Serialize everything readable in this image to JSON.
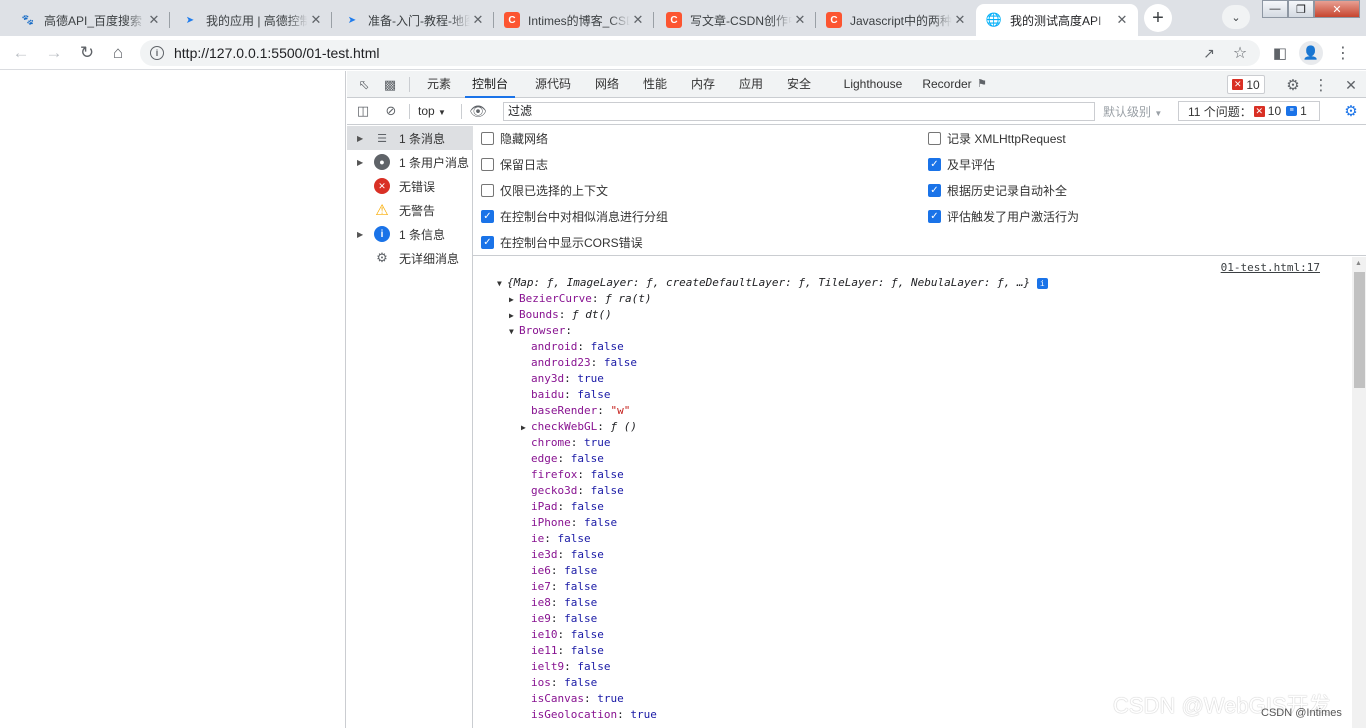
{
  "tabs": [
    {
      "title": "高德API_百度搜索",
      "icon": "baidu-paw-icon"
    },
    {
      "title": "我的应用 | 高德控制台",
      "icon": "amap-arrow-icon"
    },
    {
      "title": "准备-入门-教程-地图",
      "icon": "amap-arrow-icon"
    },
    {
      "title": "Intimes的博客_CSDN",
      "icon": "csdn-icon"
    },
    {
      "title": "写文章-CSDN创作中心",
      "icon": "csdn-icon"
    },
    {
      "title": "Javascript中的两种",
      "icon": "csdn-icon"
    },
    {
      "title": "我的测试高度API",
      "icon": "globe-icon"
    }
  ],
  "address": {
    "url": "http://127.0.0.1:5500/01-test.html",
    "host": "127.0.0.1:5500/01-test.html",
    "scheme": "http://"
  },
  "devtools": {
    "tabs": [
      "元素",
      "控制台",
      "源代码",
      "网络",
      "性能",
      "内存",
      "应用",
      "安全",
      "Lighthouse",
      "Recorder"
    ],
    "error_count": "10",
    "context": "top",
    "filter_placeholder": "过滤",
    "levels_label": "默认级别",
    "issues_label": "11 个问题：",
    "issues_errors": "10",
    "issues_info": "1"
  },
  "sidebar": [
    {
      "label": "1 条消息",
      "icon": "list-icon",
      "expandable": true
    },
    {
      "label": "1 条用户消息",
      "icon": "user-icon",
      "expandable": true
    },
    {
      "label": "无错误",
      "icon": "error-icon",
      "expandable": false
    },
    {
      "label": "无警告",
      "icon": "warning-icon",
      "expandable": false
    },
    {
      "label": "1 条信息",
      "icon": "info-icon",
      "expandable": true
    },
    {
      "label": "无详细消息",
      "icon": "verbose-bug-icon",
      "expandable": false
    }
  ],
  "settings": {
    "left": [
      {
        "label": "隐藏网络",
        "checked": false
      },
      {
        "label": "保留日志",
        "checked": false
      },
      {
        "label": "仅限已选择的上下文",
        "checked": false
      },
      {
        "label": "在控制台中对相似消息进行分组",
        "checked": true
      },
      {
        "label": "在控制台中显示CORS错误",
        "checked": true
      }
    ],
    "right": [
      {
        "label": "记录 XMLHttpRequest",
        "checked": false
      },
      {
        "label": "及早评估",
        "checked": true
      },
      {
        "label": "根据历史记录自动补全",
        "checked": true
      },
      {
        "label": "评估触发了用户激活行为",
        "checked": true
      }
    ]
  },
  "console": {
    "source_link": "01-test.html:17",
    "summary": "{Map: ƒ, ImageLayer: ƒ, createDefaultLayer: ƒ, TileLayer: ƒ, NebulaLayer: ƒ, …}",
    "top_props": [
      {
        "key": "BezierCurve",
        "val": "ƒ ra(t)"
      },
      {
        "key": "Bounds",
        "val": "ƒ dt()"
      }
    ],
    "browser_key": "Browser",
    "browser_props": [
      {
        "key": "android",
        "val": "false",
        "t": "b"
      },
      {
        "key": "android23",
        "val": "false",
        "t": "b"
      },
      {
        "key": "any3d",
        "val": "true",
        "t": "b"
      },
      {
        "key": "baidu",
        "val": "false",
        "t": "b"
      },
      {
        "key": "baseRender",
        "val": "\"w\"",
        "t": "s"
      },
      {
        "key": "checkWebGL",
        "val": "ƒ ()",
        "t": "f"
      },
      {
        "key": "chrome",
        "val": "true",
        "t": "b"
      },
      {
        "key": "edge",
        "val": "false",
        "t": "b"
      },
      {
        "key": "firefox",
        "val": "false",
        "t": "b"
      },
      {
        "key": "gecko3d",
        "val": "false",
        "t": "b"
      },
      {
        "key": "iPad",
        "val": "false",
        "t": "b"
      },
      {
        "key": "iPhone",
        "val": "false",
        "t": "b"
      },
      {
        "key": "ie",
        "val": "false",
        "t": "b"
      },
      {
        "key": "ie3d",
        "val": "false",
        "t": "b"
      },
      {
        "key": "ie6",
        "val": "false",
        "t": "b"
      },
      {
        "key": "ie7",
        "val": "false",
        "t": "b"
      },
      {
        "key": "ie8",
        "val": "false",
        "t": "b"
      },
      {
        "key": "ie9",
        "val": "false",
        "t": "b"
      },
      {
        "key": "ie10",
        "val": "false",
        "t": "b"
      },
      {
        "key": "ie11",
        "val": "false",
        "t": "b"
      },
      {
        "key": "ielt9",
        "val": "false",
        "t": "b"
      },
      {
        "key": "ios",
        "val": "false",
        "t": "b"
      },
      {
        "key": "isCanvas",
        "val": "true",
        "t": "b"
      },
      {
        "key": "isGeolocation",
        "val": "true",
        "t": "b"
      }
    ]
  },
  "watermark": "CSDN @WebGIS开发",
  "watermark_small": "CSDN @Intimes"
}
